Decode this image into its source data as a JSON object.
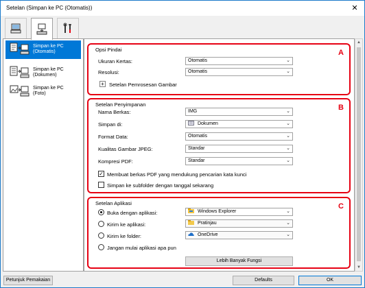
{
  "window": {
    "title": "Setelan (Simpan ke PC (Otomatis))",
    "close_glyph": "✕"
  },
  "tabs": [
    {
      "icon": "computer-scan-icon"
    },
    {
      "icon": "scan-to-pc-icon"
    },
    {
      "icon": "tools-icon"
    }
  ],
  "sidebar": {
    "items": [
      {
        "label_line1": "Simpan ke PC",
        "label_line2": "(Otomatis)",
        "icon": "auto-save-pc-icon",
        "selected": true
      },
      {
        "label_line1": "Simpan ke PC",
        "label_line2": "(Dokumen)",
        "icon": "document-save-pc-icon",
        "selected": false
      },
      {
        "label_line1": "Simpan ke PC",
        "label_line2": "(Foto)",
        "icon": "photo-save-pc-icon",
        "selected": false
      }
    ]
  },
  "section_a": {
    "title": "Opsi Pindai",
    "letter": "A",
    "paper_size_label": "Ukuran Kertas:",
    "paper_size_value": "Otomatis",
    "resolution_label": "Resolusi:",
    "resolution_value": "Otomatis",
    "expand_glyph": "+",
    "image_processing_label": "Setelan Pemrosesan Gambar"
  },
  "section_b": {
    "title": "Setelan Penyimpanan",
    "letter": "B",
    "file_name_label": "Nama Berkas:",
    "file_name_value": "IMG",
    "save_in_label": "Simpan di:",
    "save_in_value": "Dokumen",
    "data_format_label": "Format Data:",
    "data_format_value": "Otomatis",
    "jpeg_quality_label": "Kualitas Gambar JPEG:",
    "jpeg_quality_value": "Standar",
    "pdf_compression_label": "Kompresi PDF:",
    "pdf_compression_value": "Standar",
    "searchable_pdf_label": "Membuat berkas PDF yang mendukung pencarian kata kunci",
    "searchable_pdf_checked": true,
    "subfolder_label": "Simpan ke subfolder dengan tanggal sekarang",
    "subfolder_checked": false,
    "check_glyph": "✓"
  },
  "section_c": {
    "title": "Setelan Aplikasi",
    "letter": "C",
    "open_with_label": "Buka dengan aplikasi:",
    "open_with_value": "Windows Explorer",
    "send_to_app_label": "Kirim ke aplikasi:",
    "send_to_app_value": "Pratinjau",
    "send_to_folder_label": "Kirim ke folder:",
    "send_to_folder_value": "OneDrive",
    "no_app_label": "Jangan mulai aplikasi apa pun",
    "more_functions_label": "Lebih Banyak Fungsi",
    "selected_option": "open_with"
  },
  "footer": {
    "instructions_label": "Petunjuk Pemakaian",
    "defaults_label": "Defaults",
    "ok_label": "OK"
  },
  "colors": {
    "accent": "#0078d7",
    "section_border": "#e60012"
  }
}
